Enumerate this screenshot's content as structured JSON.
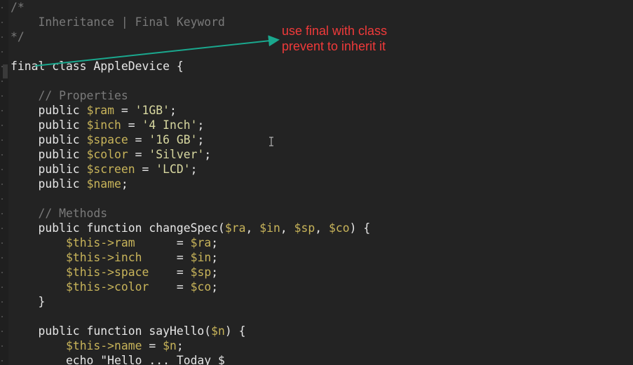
{
  "code_lines": [
    [
      {
        "t": "/*",
        "c": "comment"
      }
    ],
    [
      {
        "t": "    Inheritance | Final Keyword",
        "c": "comment"
      }
    ],
    [
      {
        "t": "*/",
        "c": "comment"
      }
    ],
    [
      {
        "t": "",
        "c": "plain"
      }
    ],
    [
      {
        "t": "final class AppleDevice {",
        "c": "plain"
      }
    ],
    [
      {
        "t": "",
        "c": "plain"
      }
    ],
    [
      {
        "t": "    // Properties",
        "c": "comment"
      }
    ],
    [
      {
        "t": "    public ",
        "c": "plain"
      },
      {
        "t": "$ram",
        "c": "var"
      },
      {
        "t": " = ",
        "c": "plain"
      },
      {
        "t": "'1GB'",
        "c": "str"
      },
      {
        "t": ";",
        "c": "plain"
      }
    ],
    [
      {
        "t": "    public ",
        "c": "plain"
      },
      {
        "t": "$inch",
        "c": "var"
      },
      {
        "t": " = ",
        "c": "plain"
      },
      {
        "t": "'4 Inch'",
        "c": "str"
      },
      {
        "t": ";",
        "c": "plain"
      }
    ],
    [
      {
        "t": "    public ",
        "c": "plain"
      },
      {
        "t": "$space",
        "c": "var"
      },
      {
        "t": " = ",
        "c": "plain"
      },
      {
        "t": "'16 GB'",
        "c": "str"
      },
      {
        "t": ";",
        "c": "plain"
      }
    ],
    [
      {
        "t": "    public ",
        "c": "plain"
      },
      {
        "t": "$color",
        "c": "var"
      },
      {
        "t": " = ",
        "c": "plain"
      },
      {
        "t": "'Silver'",
        "c": "str"
      },
      {
        "t": ";",
        "c": "plain"
      }
    ],
    [
      {
        "t": "    public ",
        "c": "plain"
      },
      {
        "t": "$screen",
        "c": "var"
      },
      {
        "t": " = ",
        "c": "plain"
      },
      {
        "t": "'LCD'",
        "c": "str"
      },
      {
        "t": ";",
        "c": "plain"
      }
    ],
    [
      {
        "t": "    public ",
        "c": "plain"
      },
      {
        "t": "$name",
        "c": "var"
      },
      {
        "t": ";",
        "c": "plain"
      }
    ],
    [
      {
        "t": "",
        "c": "plain"
      }
    ],
    [
      {
        "t": "    // Methods",
        "c": "comment"
      }
    ],
    [
      {
        "t": "    public function changeSpec(",
        "c": "plain"
      },
      {
        "t": "$ra",
        "c": "var"
      },
      {
        "t": ", ",
        "c": "plain"
      },
      {
        "t": "$in",
        "c": "var"
      },
      {
        "t": ", ",
        "c": "plain"
      },
      {
        "t": "$sp",
        "c": "var"
      },
      {
        "t": ", ",
        "c": "plain"
      },
      {
        "t": "$co",
        "c": "var"
      },
      {
        "t": ") {",
        "c": "plain"
      }
    ],
    [
      {
        "t": "        ",
        "c": "plain"
      },
      {
        "t": "$this->ram",
        "c": "var"
      },
      {
        "t": "      = ",
        "c": "plain"
      },
      {
        "t": "$ra",
        "c": "var"
      },
      {
        "t": ";",
        "c": "plain"
      }
    ],
    [
      {
        "t": "        ",
        "c": "plain"
      },
      {
        "t": "$this->inch",
        "c": "var"
      },
      {
        "t": "     = ",
        "c": "plain"
      },
      {
        "t": "$in",
        "c": "var"
      },
      {
        "t": ";",
        "c": "plain"
      }
    ],
    [
      {
        "t": "        ",
        "c": "plain"
      },
      {
        "t": "$this->space",
        "c": "var"
      },
      {
        "t": "    = ",
        "c": "plain"
      },
      {
        "t": "$sp",
        "c": "var"
      },
      {
        "t": ";",
        "c": "plain"
      }
    ],
    [
      {
        "t": "        ",
        "c": "plain"
      },
      {
        "t": "$this->color",
        "c": "var"
      },
      {
        "t": "    = ",
        "c": "plain"
      },
      {
        "t": "$co",
        "c": "var"
      },
      {
        "t": ";",
        "c": "plain"
      }
    ],
    [
      {
        "t": "    }",
        "c": "plain"
      }
    ],
    [
      {
        "t": "",
        "c": "plain"
      }
    ],
    [
      {
        "t": "    public function sayHello(",
        "c": "plain"
      },
      {
        "t": "$n",
        "c": "var"
      },
      {
        "t": ") {",
        "c": "plain"
      }
    ],
    [
      {
        "t": "        ",
        "c": "plain"
      },
      {
        "t": "$this->name",
        "c": "var"
      },
      {
        "t": " = ",
        "c": "plain"
      },
      {
        "t": "$n",
        "c": "var"
      },
      {
        "t": ";",
        "c": "plain"
      }
    ],
    [
      {
        "t": "        echo \"Hello ... Today $",
        "c": "plain"
      }
    ]
  ],
  "annotation": {
    "line1": "use final with class",
    "line2": "prevent to inherit it"
  },
  "colors": {
    "background": "#232323",
    "annotation_text": "#f03a3a",
    "arrow": "#1aa88e",
    "variable": "#c8b45a",
    "comment": "#7a7a7a"
  }
}
